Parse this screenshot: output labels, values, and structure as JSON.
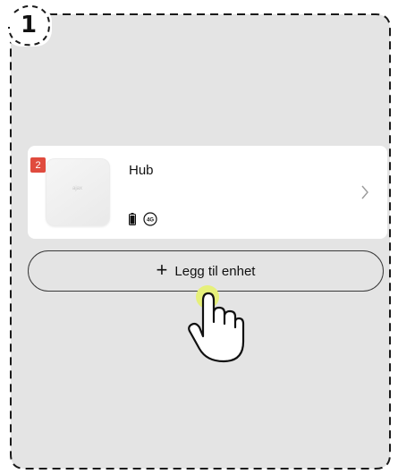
{
  "step": {
    "number": "1"
  },
  "device": {
    "name": "Hub",
    "badge_count": "2",
    "status_icons": [
      "battery-icon",
      "4g-network-icon"
    ],
    "network_label": "4G",
    "logo_text": "ajax"
  },
  "add_button": {
    "label": "Legg til enhet",
    "icon": "plus-icon"
  },
  "colors": {
    "panel": "#e4e4e4",
    "card": "#ffffff",
    "badge": "#e04b3e",
    "highlight": "#e6f07a"
  }
}
